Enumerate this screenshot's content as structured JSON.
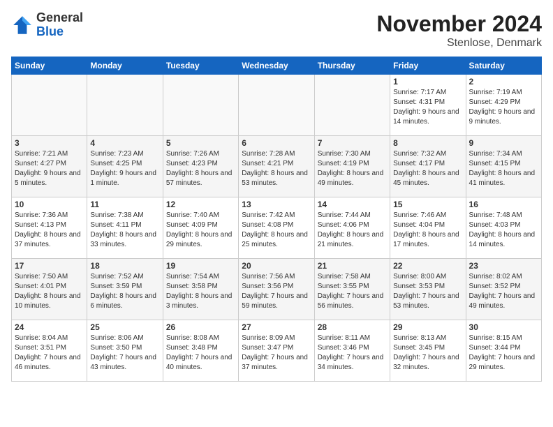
{
  "header": {
    "logo_general": "General",
    "logo_blue": "Blue",
    "month_title": "November 2024",
    "location": "Stenlose, Denmark"
  },
  "weekdays": [
    "Sunday",
    "Monday",
    "Tuesday",
    "Wednesday",
    "Thursday",
    "Friday",
    "Saturday"
  ],
  "weeks": [
    [
      {
        "day": "",
        "info": ""
      },
      {
        "day": "",
        "info": ""
      },
      {
        "day": "",
        "info": ""
      },
      {
        "day": "",
        "info": ""
      },
      {
        "day": "",
        "info": ""
      },
      {
        "day": "1",
        "info": "Sunrise: 7:17 AM\nSunset: 4:31 PM\nDaylight: 9 hours and 14 minutes."
      },
      {
        "day": "2",
        "info": "Sunrise: 7:19 AM\nSunset: 4:29 PM\nDaylight: 9 hours and 9 minutes."
      }
    ],
    [
      {
        "day": "3",
        "info": "Sunrise: 7:21 AM\nSunset: 4:27 PM\nDaylight: 9 hours and 5 minutes."
      },
      {
        "day": "4",
        "info": "Sunrise: 7:23 AM\nSunset: 4:25 PM\nDaylight: 9 hours and 1 minute."
      },
      {
        "day": "5",
        "info": "Sunrise: 7:26 AM\nSunset: 4:23 PM\nDaylight: 8 hours and 57 minutes."
      },
      {
        "day": "6",
        "info": "Sunrise: 7:28 AM\nSunset: 4:21 PM\nDaylight: 8 hours and 53 minutes."
      },
      {
        "day": "7",
        "info": "Sunrise: 7:30 AM\nSunset: 4:19 PM\nDaylight: 8 hours and 49 minutes."
      },
      {
        "day": "8",
        "info": "Sunrise: 7:32 AM\nSunset: 4:17 PM\nDaylight: 8 hours and 45 minutes."
      },
      {
        "day": "9",
        "info": "Sunrise: 7:34 AM\nSunset: 4:15 PM\nDaylight: 8 hours and 41 minutes."
      }
    ],
    [
      {
        "day": "10",
        "info": "Sunrise: 7:36 AM\nSunset: 4:13 PM\nDaylight: 8 hours and 37 minutes."
      },
      {
        "day": "11",
        "info": "Sunrise: 7:38 AM\nSunset: 4:11 PM\nDaylight: 8 hours and 33 minutes."
      },
      {
        "day": "12",
        "info": "Sunrise: 7:40 AM\nSunset: 4:09 PM\nDaylight: 8 hours and 29 minutes."
      },
      {
        "day": "13",
        "info": "Sunrise: 7:42 AM\nSunset: 4:08 PM\nDaylight: 8 hours and 25 minutes."
      },
      {
        "day": "14",
        "info": "Sunrise: 7:44 AM\nSunset: 4:06 PM\nDaylight: 8 hours and 21 minutes."
      },
      {
        "day": "15",
        "info": "Sunrise: 7:46 AM\nSunset: 4:04 PM\nDaylight: 8 hours and 17 minutes."
      },
      {
        "day": "16",
        "info": "Sunrise: 7:48 AM\nSunset: 4:03 PM\nDaylight: 8 hours and 14 minutes."
      }
    ],
    [
      {
        "day": "17",
        "info": "Sunrise: 7:50 AM\nSunset: 4:01 PM\nDaylight: 8 hours and 10 minutes."
      },
      {
        "day": "18",
        "info": "Sunrise: 7:52 AM\nSunset: 3:59 PM\nDaylight: 8 hours and 6 minutes."
      },
      {
        "day": "19",
        "info": "Sunrise: 7:54 AM\nSunset: 3:58 PM\nDaylight: 8 hours and 3 minutes."
      },
      {
        "day": "20",
        "info": "Sunrise: 7:56 AM\nSunset: 3:56 PM\nDaylight: 7 hours and 59 minutes."
      },
      {
        "day": "21",
        "info": "Sunrise: 7:58 AM\nSunset: 3:55 PM\nDaylight: 7 hours and 56 minutes."
      },
      {
        "day": "22",
        "info": "Sunrise: 8:00 AM\nSunset: 3:53 PM\nDaylight: 7 hours and 53 minutes."
      },
      {
        "day": "23",
        "info": "Sunrise: 8:02 AM\nSunset: 3:52 PM\nDaylight: 7 hours and 49 minutes."
      }
    ],
    [
      {
        "day": "24",
        "info": "Sunrise: 8:04 AM\nSunset: 3:51 PM\nDaylight: 7 hours and 46 minutes."
      },
      {
        "day": "25",
        "info": "Sunrise: 8:06 AM\nSunset: 3:50 PM\nDaylight: 7 hours and 43 minutes."
      },
      {
        "day": "26",
        "info": "Sunrise: 8:08 AM\nSunset: 3:48 PM\nDaylight: 7 hours and 40 minutes."
      },
      {
        "day": "27",
        "info": "Sunrise: 8:09 AM\nSunset: 3:47 PM\nDaylight: 7 hours and 37 minutes."
      },
      {
        "day": "28",
        "info": "Sunrise: 8:11 AM\nSunset: 3:46 PM\nDaylight: 7 hours and 34 minutes."
      },
      {
        "day": "29",
        "info": "Sunrise: 8:13 AM\nSunset: 3:45 PM\nDaylight: 7 hours and 32 minutes."
      },
      {
        "day": "30",
        "info": "Sunrise: 8:15 AM\nSunset: 3:44 PM\nDaylight: 7 hours and 29 minutes."
      }
    ]
  ]
}
